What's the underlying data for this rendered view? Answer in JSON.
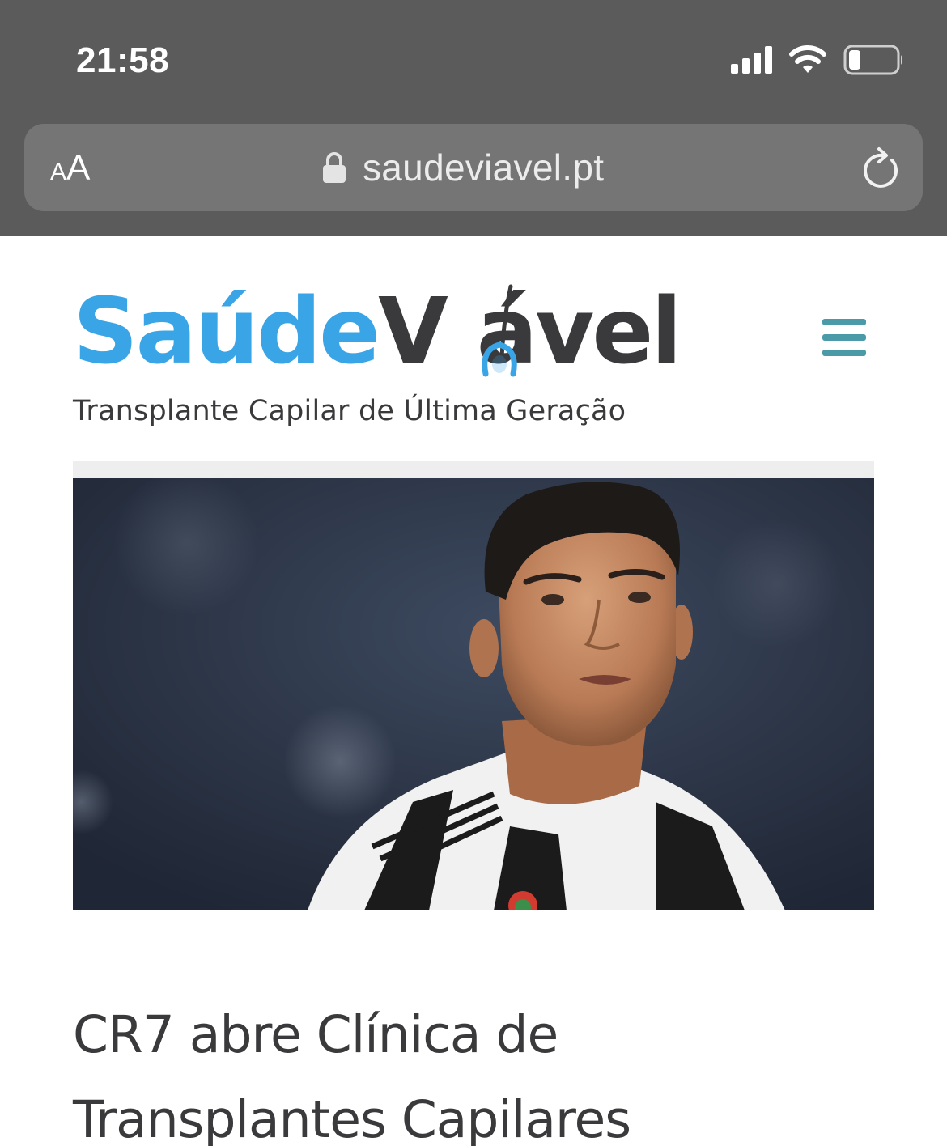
{
  "status_bar": {
    "time": "21:58",
    "icons": [
      "cellular-signal-icon",
      "wifi-icon",
      "battery-icon"
    ]
  },
  "url_bar": {
    "text_size_label_small": "A",
    "text_size_label_big": "A",
    "url": "saudeviavel.pt",
    "icons": [
      "lock-icon",
      "reload-icon"
    ]
  },
  "site": {
    "logo": {
      "part1": "Saúde",
      "part2": "V",
      "part3": "ável",
      "tagline": "Transplante Capilar de Última Geração"
    },
    "menu_icon": "hamburger-menu-icon",
    "hero_image_description": "player-portrait",
    "article": {
      "title": "CR7 abre Clínica de Transplantes Capilares"
    }
  },
  "colors": {
    "chrome_bg": "#5b5b5b",
    "url_bar_bg": "#757575",
    "logo_blue": "#3aa5e6",
    "logo_dark": "#3a3a3c",
    "menu_teal": "#4a9aa8"
  }
}
